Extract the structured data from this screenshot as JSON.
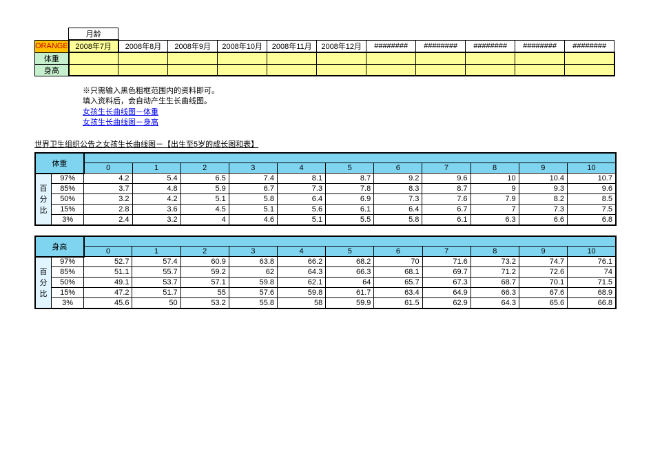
{
  "input": {
    "row1_label": "月龄",
    "orange_label": "ORANGE",
    "months": [
      "2008年7月",
      "2008年8月",
      "2008年9月",
      "2008年10月",
      "2008年11月",
      "2008年12月",
      "########",
      "########",
      "########",
      "########",
      "########"
    ],
    "weight_label": "体重",
    "height_label": "身高",
    "weight_vals": [
      "",
      "",
      "",
      "",
      "",
      "",
      "",
      "",
      "",
      "",
      ""
    ],
    "height_vals": [
      "",
      "",
      "",
      "",
      "",
      "",
      "",
      "",
      "",
      "",
      ""
    ]
  },
  "notes": {
    "l1": "※只需输入黑色粗框范围内的资料即可。",
    "l2": "填入资料后，会自动产生生长曲线图。",
    "link1": "女孩生长曲线图－体重",
    "link2": "女孩生长曲线图－身高"
  },
  "section_title": "世界卫生组织公告之女孩生长曲线图－【出生至5岁的成长图和表】",
  "vert_label": "百分比",
  "percentiles": [
    "97%",
    "85%",
    "50%",
    "15%",
    "3%"
  ],
  "months_hdr": [
    "0",
    "1",
    "2",
    "3",
    "4",
    "5",
    "6",
    "7",
    "8",
    "9",
    "10"
  ],
  "weight": {
    "title": "体重",
    "rows": [
      [
        4.2,
        5.4,
        6.5,
        7.4,
        8.1,
        8.7,
        9.2,
        9.6,
        10,
        10.4,
        10.7
      ],
      [
        3.7,
        4.8,
        5.9,
        6.7,
        7.3,
        7.8,
        8.3,
        8.7,
        9,
        9.3,
        9.6
      ],
      [
        3.2,
        4.2,
        5.1,
        5.8,
        6.4,
        6.9,
        7.3,
        7.6,
        7.9,
        8.2,
        8.5
      ],
      [
        2.8,
        3.6,
        4.5,
        5.1,
        5.6,
        6.1,
        6.4,
        6.7,
        7,
        7.3,
        7.5
      ],
      [
        2.4,
        3.2,
        4,
        4.6,
        5.1,
        5.5,
        5.8,
        6.1,
        6.3,
        6.6,
        6.8
      ]
    ]
  },
  "height": {
    "title": "身高",
    "rows": [
      [
        52.7,
        57.4,
        60.9,
        63.8,
        66.2,
        68.2,
        70,
        71.6,
        73.2,
        74.7,
        76.1
      ],
      [
        51.1,
        55.7,
        59.2,
        62,
        64.3,
        66.3,
        68.1,
        69.7,
        71.2,
        72.6,
        74
      ],
      [
        49.1,
        53.7,
        57.1,
        59.8,
        62.1,
        64,
        65.7,
        67.3,
        68.7,
        70.1,
        71.5
      ],
      [
        47.2,
        51.7,
        55,
        57.6,
        59.8,
        61.7,
        63.4,
        64.9,
        66.3,
        67.6,
        68.9
      ],
      [
        45.6,
        50,
        53.2,
        55.8,
        58,
        59.9,
        61.5,
        62.9,
        64.3,
        65.6,
        66.8
      ]
    ]
  }
}
